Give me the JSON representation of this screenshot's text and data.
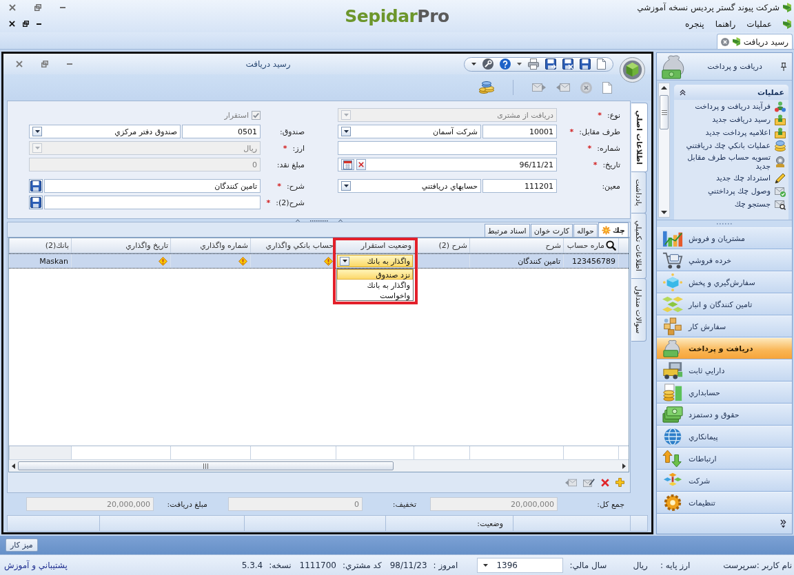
{
  "app": {
    "title": "شرکت پیوند گستر پردیس نسخه آموزشي",
    "logo": "Sepidar",
    "logo_accent": "Pro"
  },
  "menu": [
    "عمليات",
    "راهنما",
    "پنجره"
  ],
  "doc_tabs": [
    {
      "label": "رسید دریافت",
      "selected": true
    }
  ],
  "form_window": {
    "title": "رسید دریافت",
    "fields_column_1": [
      {
        "kind": "combo",
        "label": "نوع:",
        "required_mark": "*",
        "value": "دریافت از مشتری",
        "disabled": true
      },
      {
        "kind": "code_combo",
        "label": "طرف مقابل:",
        "required_mark": "*",
        "code": "10001",
        "value": "شرکت آسمان",
        "disabled": false
      },
      {
        "kind": "text",
        "label": "شماره:",
        "required_mark": "*",
        "disabled": false
      },
      {
        "kind": "date",
        "label": "تاریخ:",
        "required_mark": "*",
        "value": "96/11/21",
        "disabled": false
      },
      {
        "kind": "code_combo",
        "label": "معین:",
        "code": "111201",
        "value": "حسابهاي دريافتني",
        "disabled": false
      }
    ],
    "fields_column_2": [
      {
        "kind": "check",
        "label": "استقرار",
        "checked": true,
        "disabled": true
      },
      {
        "kind": "code_combo",
        "label": "صندوق:",
        "code": "0501",
        "value": "صندوق دفتر مرکزي",
        "disabled": false
      },
      {
        "kind": "combo",
        "label": "ارز:",
        "required_mark": "*",
        "value": "ريال",
        "disabled": true
      },
      {
        "kind": "text",
        "label": "مبلغ نقد:",
        "value": "0",
        "disabled": true
      },
      {
        "kind": "text_save",
        "label": "شرح:",
        "required_mark": "*",
        "value": "تامین کنندگان",
        "disabled": false
      },
      {
        "kind": "text_save",
        "label": "شرح(2):",
        "required_mark": "*",
        "disabled": false
      }
    ],
    "side_tabs": [
      {
        "label": "اطلاعات اصلي",
        "selected": true
      },
      {
        "label": "يادداشت",
        "selected": false
      },
      {
        "label": "اطلاعات تکميلي",
        "selected": false
      },
      {
        "label": "سوالات متداول",
        "selected": false
      }
    ],
    "detail": {
      "tabs": [
        {
          "label": "چك",
          "selected": true
        },
        {
          "label": "حواله",
          "selected": false
        },
        {
          "label": "كارت خوان",
          "selected": false
        },
        {
          "label": "اسناد مرتبط",
          "selected": false
        }
      ],
      "columns": [
        "ماره حساب",
        "شرح",
        "شرح (2)",
        "وضعيت استقرار",
        "حساب بانكي واگذاري",
        "شماره واگذاري",
        "تاريخ واگذاري",
        "بانك(2)"
      ],
      "rows": [
        {
          "selected": true,
          "cells": [
            {
              "kind": "text",
              "value": "123456789"
            },
            {
              "kind": "text",
              "value": "تامین کنندگان"
            },
            {
              "kind": "empty"
            },
            {
              "kind": "combo",
              "value": "واگذار به بانك"
            },
            {
              "kind": "warning"
            },
            {
              "kind": "warning"
            },
            {
              "kind": "warning"
            },
            {
              "kind": "text",
              "value": "Maskan"
            }
          ]
        }
      ],
      "open_list": {
        "highlighted": true,
        "options": [
          {
            "label": "نزد صندوق",
            "selected": true
          },
          {
            "label": "واگذار به بانك",
            "selected": false
          },
          {
            "label": "واخواست",
            "selected": false
          }
        ]
      }
    },
    "totals": [
      {
        "label": "جمع کل:",
        "value": "20,000,000"
      },
      {
        "label": "تخفيف:",
        "value": "0"
      },
      {
        "label": "مبلغ دريافت:",
        "value": "20,000,000"
      }
    ],
    "status_label": "وضعيت:"
  },
  "nav": {
    "title": "دريافت و پرداخت",
    "group": {
      "title": "عمليات",
      "expanded": true,
      "items": [
        "فرآيند دريافت و پرداخت",
        "رسيد دريافت جديد",
        "اعلاميه پرداخت جديد",
        "عمليات بانکي چك دريافتني",
        "تسويه حساب طرف مقابل جديد",
        "استرداد چك جديد",
        "وصول چك پرداختني",
        "جستجو چك"
      ]
    },
    "modules": [
      {
        "label": "مشتريان و فروش",
        "selected": false
      },
      {
        "label": "خرده فروشي",
        "selected": false
      },
      {
        "label": "سفارش‌گيري و پخش",
        "selected": false
      },
      {
        "label": "تامين کنندگان و انبار",
        "selected": false
      },
      {
        "label": "سفارش کار",
        "selected": false
      },
      {
        "label": "دريافت و پرداخت",
        "selected": true
      },
      {
        "label": "دارايي ثابت",
        "selected": false
      },
      {
        "label": "حسابداري",
        "selected": false
      },
      {
        "label": "حقوق و دستمزد",
        "selected": false
      },
      {
        "label": "پيمانکاري",
        "selected": false
      },
      {
        "label": "ارتباطات",
        "selected": false
      },
      {
        "label": "شرکت",
        "selected": false
      },
      {
        "label": "تنظيمات",
        "selected": false
      }
    ]
  },
  "taskbar": [
    "ميز کار"
  ],
  "status_bar": {
    "items": [
      {
        "kind": "text",
        "label": "نام کاربر :سرپرست"
      },
      {
        "kind": "pair",
        "label": "ارز پايه :",
        "value": "ريال"
      },
      {
        "kind": "select",
        "label": "سال مالي:",
        "value": "1396"
      },
      {
        "kind": "pair",
        "label": "امروز :",
        "value": "98/11/23"
      },
      {
        "kind": "pair",
        "label": "کد مشتري:",
        "value": "1111700"
      },
      {
        "kind": "pair",
        "label": "نسخه:",
        "value": "5.3.4"
      }
    ],
    "link": "پشتيباني و آموزش"
  }
}
